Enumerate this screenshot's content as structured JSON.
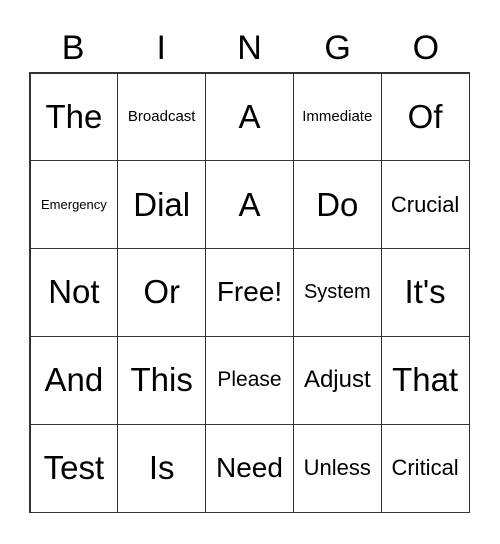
{
  "header": [
    "B",
    "I",
    "N",
    "G",
    "O"
  ],
  "cells": [
    [
      "The",
      "Broadcast",
      "A",
      "Immediate",
      "Of"
    ],
    [
      "Emergency",
      "Dial",
      "A",
      "Do",
      "Crucial"
    ],
    [
      "Not",
      "Or",
      "Free!",
      "System",
      "It's"
    ],
    [
      "And",
      "This",
      "Please",
      "Adjust",
      "That"
    ],
    [
      "Test",
      "Is",
      "Need",
      "Unless",
      "Critical"
    ]
  ]
}
